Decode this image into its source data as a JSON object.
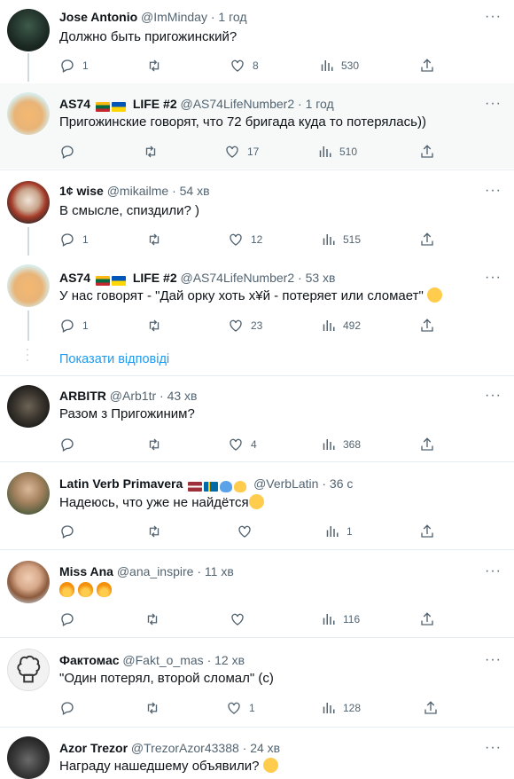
{
  "tweets": [
    {
      "name": "Jose Antonio",
      "handle": "@ImMinday",
      "time": "1 год",
      "text": "Должно быть пригожинский?",
      "replies": "1",
      "retweets": "",
      "likes": "8",
      "views": "530"
    },
    {
      "name": "AS74",
      "name_suffix": "LIFE #2",
      "handle": "@AS74LifeNumber2",
      "time": "1 год",
      "text": "Пригожинские говорят, что 72 бригада куда то потерялась))",
      "replies": "",
      "retweets": "",
      "likes": "17",
      "views": "510"
    },
    {
      "name": "1¢ wise",
      "handle": "@mikailme",
      "time": "54 хв",
      "text": "В смысле, спиздили? )",
      "replies": "1",
      "retweets": "",
      "likes": "12",
      "views": "515"
    },
    {
      "name": "AS74",
      "name_suffix": "LIFE #2",
      "handle": "@AS74LifeNumber2",
      "time": "53 хв",
      "text": "У нас говорят - \"Дай орку хоть х¥й - потеряет или сломает\"",
      "replies": "1",
      "retweets": "",
      "likes": "23",
      "views": "492"
    },
    {
      "name": "ARBITR",
      "handle": "@Arb1tr",
      "time": "43 хв",
      "text": "Разом з Пригожиним?",
      "replies": "",
      "retweets": "",
      "likes": "4",
      "views": "368"
    },
    {
      "name": "Latin Verb Primavera",
      "handle": "@VerbLatin",
      "time": "36 с",
      "text": "Надеюсь, что уже не найдётся",
      "replies": "",
      "retweets": "",
      "likes": "",
      "views": "1"
    },
    {
      "name": "Miss Ana",
      "handle": "@ana_inspire",
      "time": "11 хв",
      "text": "",
      "replies": "",
      "retweets": "",
      "likes": "",
      "views": "116"
    },
    {
      "name": "Фактомас",
      "handle": "@Fakt_o_mas",
      "time": "12 хв",
      "text": "\"Один потерял, второй сломал\" (с)",
      "replies": "",
      "retweets": "",
      "likes": "1",
      "views": "128"
    },
    {
      "name": "Azor Trezor",
      "handle": "@TrezorAzor43388",
      "time": "24 хв",
      "text": "Награду нашедшему объявили?",
      "replies": "",
      "retweets": "",
      "likes": "",
      "views": ""
    }
  ],
  "show_replies_label": "Показати відповіді",
  "icons": [
    "reply-icon",
    "retweet-icon",
    "like-icon",
    "views-icon",
    "share-icon",
    "more-icon"
  ],
  "colors": {
    "link": "#1d9bf0",
    "muted": "#536471",
    "text": "#0f1419",
    "highlight_bg": "#f7f9f9"
  }
}
